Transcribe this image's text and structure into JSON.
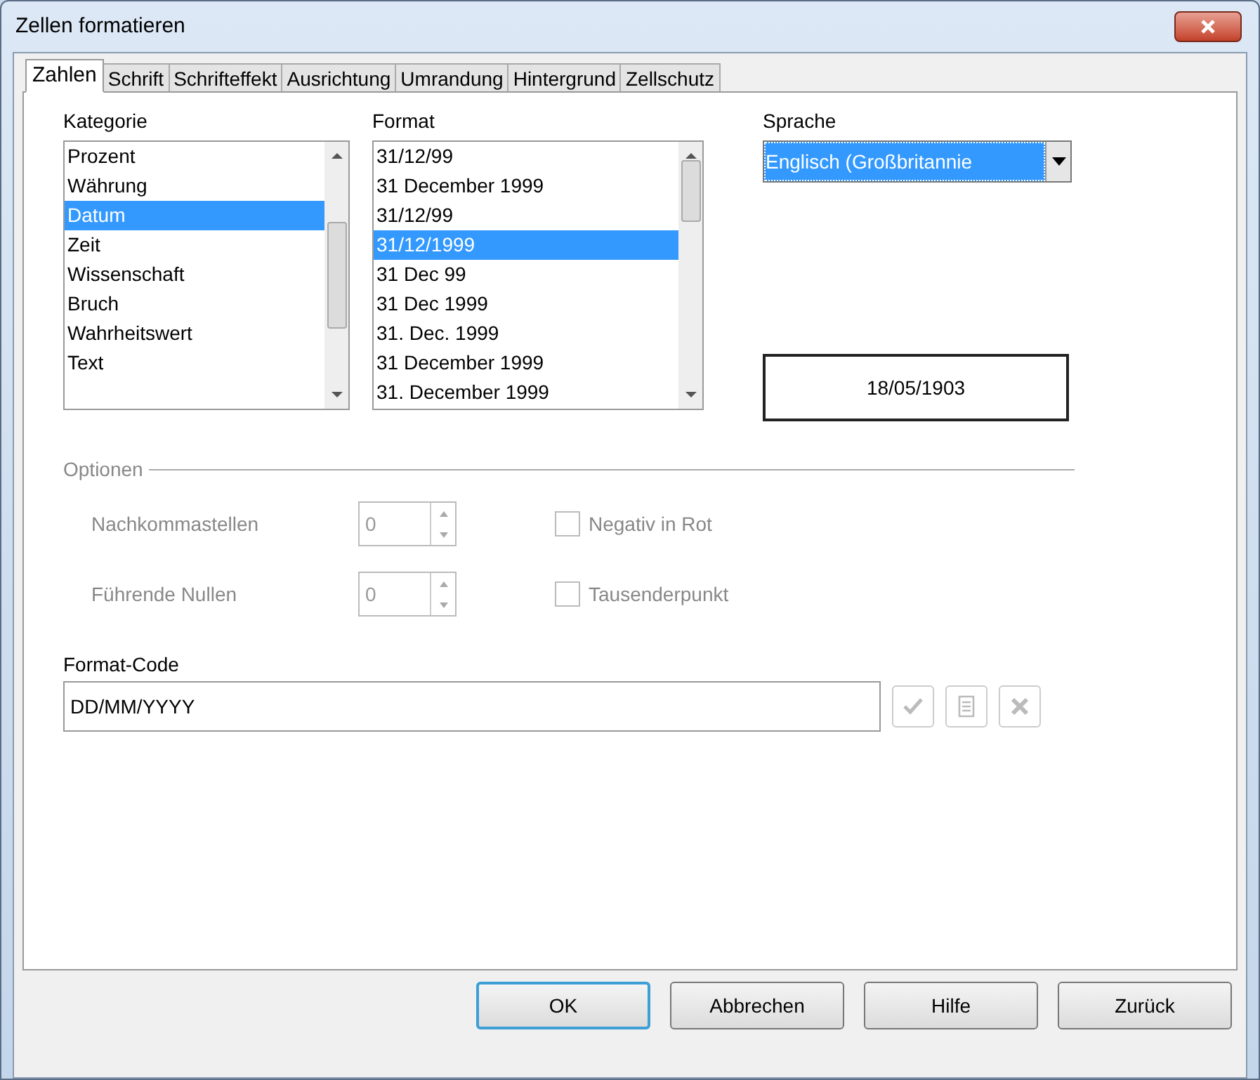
{
  "window": {
    "title": "Zellen formatieren"
  },
  "tabs": [
    {
      "label": "Zahlen",
      "selected": true
    },
    {
      "label": "Schrift",
      "selected": false
    },
    {
      "label": "Schrifteffekt",
      "selected": false
    },
    {
      "label": "Ausrichtung",
      "selected": false
    },
    {
      "label": "Umrandung",
      "selected": false
    },
    {
      "label": "Hintergrund",
      "selected": false
    },
    {
      "label": "Zellschutz",
      "selected": false
    }
  ],
  "category": {
    "label": "Kategorie",
    "items": [
      {
        "label": "Prozent",
        "selected": false
      },
      {
        "label": "Währung",
        "selected": false
      },
      {
        "label": "Datum",
        "selected": true
      },
      {
        "label": "Zeit",
        "selected": false
      },
      {
        "label": "Wissenschaft",
        "selected": false
      },
      {
        "label": "Bruch",
        "selected": false
      },
      {
        "label": "Wahrheitswert",
        "selected": false
      },
      {
        "label": "Text",
        "selected": false
      }
    ]
  },
  "format": {
    "label": "Format",
    "items": [
      {
        "label": "31/12/99",
        "selected": false
      },
      {
        "label": "31 December 1999",
        "selected": false
      },
      {
        "label": "31/12/99",
        "selected": false
      },
      {
        "label": "31/12/1999",
        "selected": true
      },
      {
        "label": "31 Dec 99",
        "selected": false
      },
      {
        "label": "31 Dec 1999",
        "selected": false
      },
      {
        "label": "31. Dec. 1999",
        "selected": false
      },
      {
        "label": "31 December 1999",
        "selected": false
      },
      {
        "label": "31. December 1999",
        "selected": false
      }
    ]
  },
  "language": {
    "label": "Sprache",
    "value": "Englisch (Großbritannie"
  },
  "preview": {
    "value": "18/05/1903"
  },
  "options": {
    "title": "Optionen",
    "spinners": [
      {
        "label": "Nachkommastellen",
        "value": "0",
        "disabled": true
      },
      {
        "label": "Führende Nullen",
        "value": "0",
        "disabled": true
      }
    ],
    "checkboxes": [
      {
        "label": "Negativ in Rot",
        "checked": false,
        "disabled": true
      },
      {
        "label": "Tausenderpunkt",
        "checked": false,
        "disabled": true
      }
    ]
  },
  "format_code": {
    "label": "Format-Code",
    "value": "DD/MM/YYYY"
  },
  "buttons": [
    {
      "label": "OK",
      "default": true
    },
    {
      "label": "Abbrechen",
      "default": false
    },
    {
      "label": "Hilfe",
      "default": false
    },
    {
      "label": "Zurück",
      "default": false
    }
  ]
}
